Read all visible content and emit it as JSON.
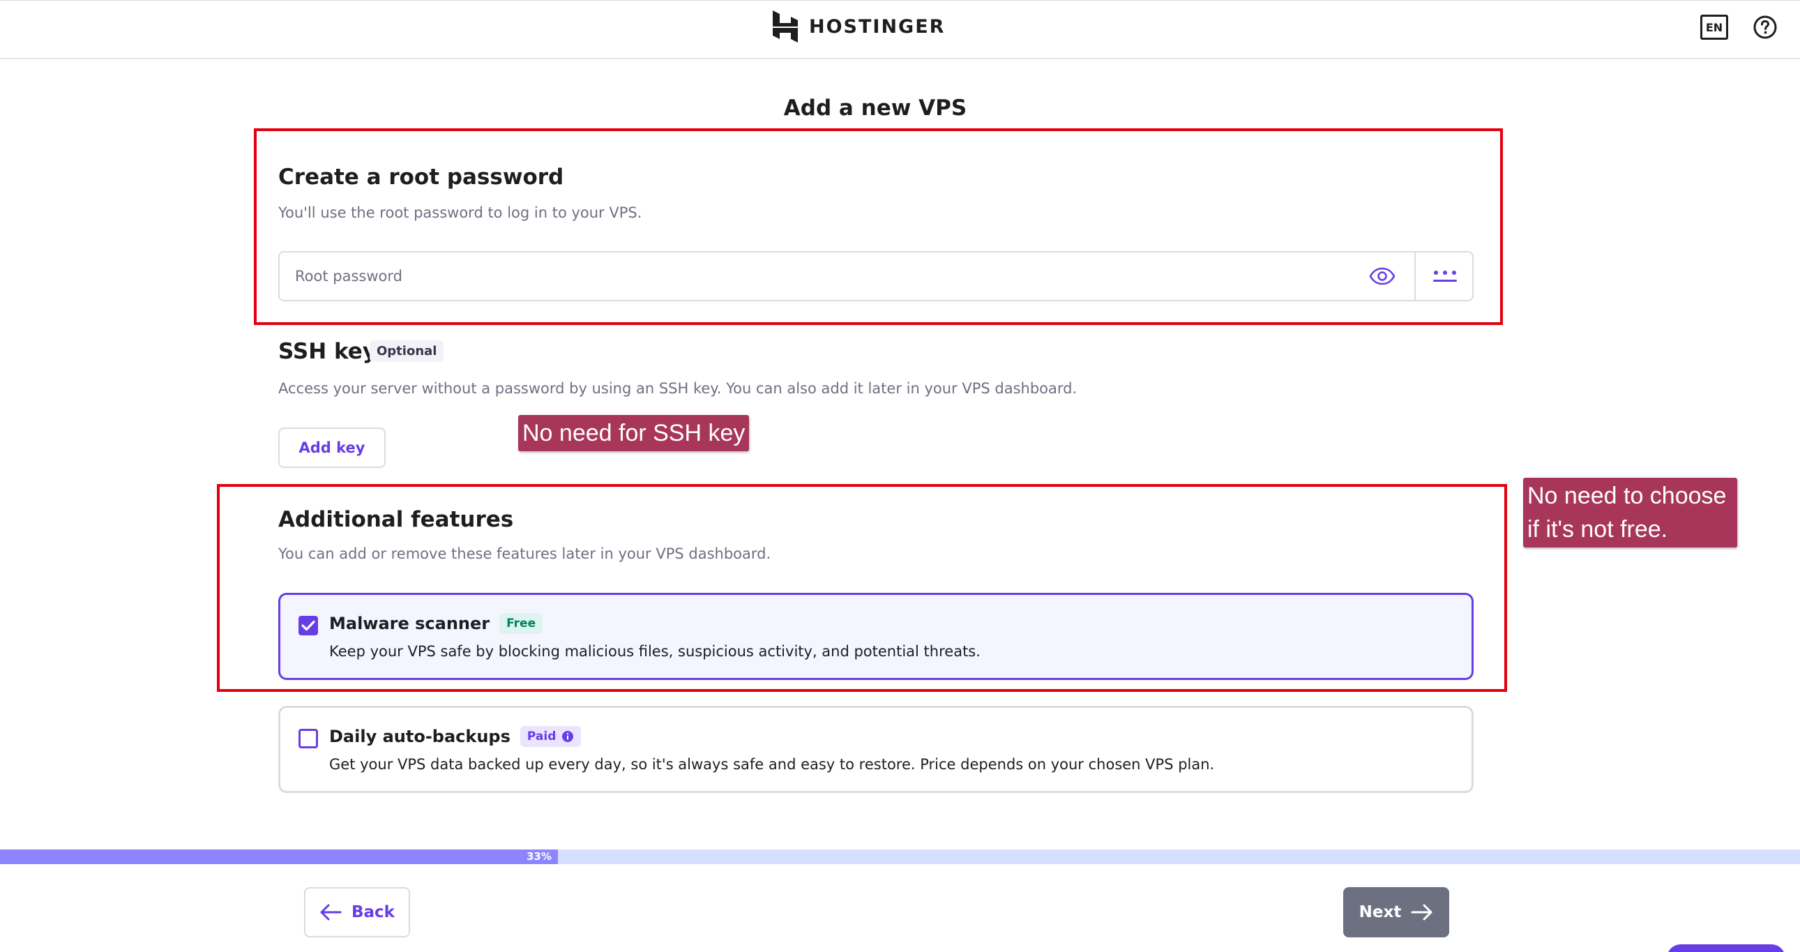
{
  "header": {
    "brand": "HOSTINGER",
    "language": "EN"
  },
  "page_title": "Add a new VPS",
  "root_password": {
    "heading": "Create a root password",
    "description": "You'll use the root password to log in to your VPS.",
    "placeholder": "Root password",
    "value": ""
  },
  "ssh_key": {
    "heading": "SSH key",
    "badge": "Optional",
    "description": "Access your server without a password by using an SSH key. You can also add it later in your VPS dashboard.",
    "button": "Add key"
  },
  "additional_features": {
    "heading": "Additional features",
    "description": "You can add or remove these features later in your VPS dashboard.",
    "items": [
      {
        "title": "Malware scanner",
        "badge": "Free",
        "description": "Keep your VPS safe by blocking malicious files, suspicious activity, and potential threats.",
        "checked": true
      },
      {
        "title": "Daily auto-backups",
        "badge": "Paid",
        "description": "Get your VPS data backed up every day, so it's always safe and easy to restore. Price depends on your chosen VPS plan.",
        "checked": false
      }
    ]
  },
  "progress": {
    "label": "33%",
    "value": 0.31
  },
  "nav": {
    "back": "Back",
    "next": "Next"
  },
  "annotations": {
    "ssh_note": "No need for SSH key",
    "free_note": "No need to choose if it's not free."
  },
  "colors": {
    "accent": "#673de6",
    "annotation_box": "#e3000f",
    "annotation_label": "#a8365a",
    "next_button": "#6d7081"
  }
}
